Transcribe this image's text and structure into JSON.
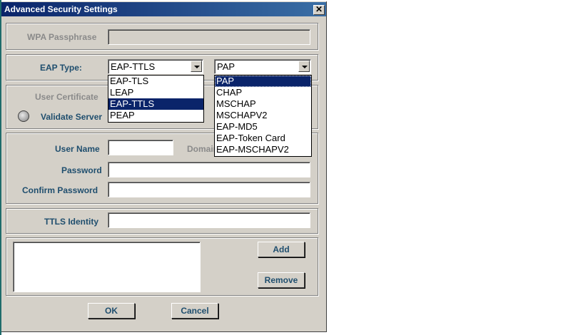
{
  "window": {
    "title": "Advanced Security Settings",
    "close_glyph": "✕"
  },
  "wpa": {
    "label": "WPA Passphrase",
    "value": ""
  },
  "eap": {
    "label": "EAP Type:",
    "type_selected": "EAP-TTLS",
    "type_options": [
      "EAP-TLS",
      "LEAP",
      "EAP-TTLS",
      "PEAP"
    ],
    "inner_selected": "PAP",
    "inner_options": [
      "PAP",
      "CHAP",
      "MSCHAP",
      "MSCHAPV2",
      "EAP-MD5",
      "EAP-Token Card",
      "EAP-MSCHAPV2"
    ]
  },
  "certificate": {
    "user_cert_label": "User Certificate",
    "validate_label": "Validate Server"
  },
  "credentials": {
    "user_name_label": "User Name",
    "user_name_value": "",
    "domain_label": "Domain",
    "password_label": "Password",
    "password_value": "",
    "confirm_label": "Confirm Password",
    "confirm_value": ""
  },
  "ttls": {
    "identity_label": "TTLS Identity",
    "identity_value": ""
  },
  "list": {
    "add_label": "Add",
    "remove_label": "Remove"
  },
  "footer": {
    "ok_label": "OK",
    "cancel_label": "Cancel"
  }
}
